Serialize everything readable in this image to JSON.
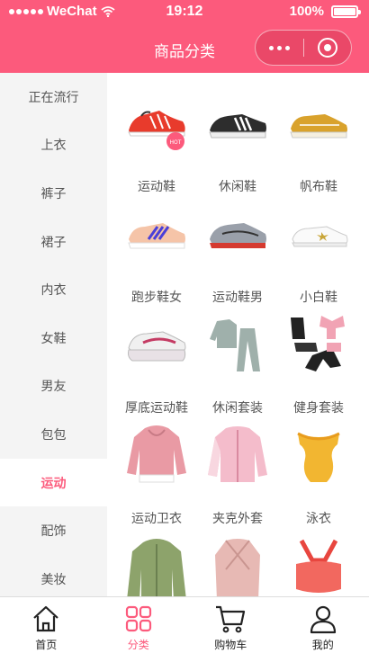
{
  "status_bar": {
    "carrier": "WeChat",
    "time": "19:12",
    "battery": "100%"
  },
  "nav": {
    "title": "商品分类"
  },
  "colors": {
    "accent": "#fc5a7c",
    "sidebar_bg": "#f4f4f4"
  },
  "sidebar": {
    "items": [
      {
        "label": "正在流行"
      },
      {
        "label": "上衣"
      },
      {
        "label": "裤子"
      },
      {
        "label": "裙子"
      },
      {
        "label": "内衣"
      },
      {
        "label": "女鞋"
      },
      {
        "label": "男友"
      },
      {
        "label": "包包"
      },
      {
        "label": "运动"
      },
      {
        "label": "配饰"
      },
      {
        "label": "美妆"
      }
    ],
    "active_label": "运动"
  },
  "products": [
    {
      "label": "运动鞋",
      "icon": "red-sneaker"
    },
    {
      "label": "休闲鞋",
      "icon": "black-sneaker"
    },
    {
      "label": "帆布鞋",
      "icon": "yellow-canvas-shoe"
    },
    {
      "label": "跑步鞋女",
      "icon": "peach-runner"
    },
    {
      "label": "运动鞋男",
      "icon": "grey-red-runner"
    },
    {
      "label": "小白鞋",
      "icon": "white-shoe"
    },
    {
      "label": "厚底运动鞋",
      "icon": "chunky-sneaker"
    },
    {
      "label": "休闲套装",
      "icon": "grey-tracksuit"
    },
    {
      "label": "健身套装",
      "icon": "fitness-set"
    },
    {
      "label": "运动卫衣",
      "icon": "pink-hoodie"
    },
    {
      "label": "夹克外套",
      "icon": "pink-jacket"
    },
    {
      "label": "泳衣",
      "icon": "yellow-swimsuit"
    },
    {
      "label": "",
      "icon": "green-jacket"
    },
    {
      "label": "",
      "icon": "pink-wrap-top"
    },
    {
      "label": "",
      "icon": "coral-sports-bra"
    }
  ],
  "badge": {
    "hot": "HOT"
  },
  "tabbar": {
    "items": [
      {
        "label": "首页",
        "icon": "home-icon"
      },
      {
        "label": "分类",
        "icon": "category-icon"
      },
      {
        "label": "购物车",
        "icon": "cart-icon"
      },
      {
        "label": "我的",
        "icon": "user-icon"
      }
    ]
  }
}
